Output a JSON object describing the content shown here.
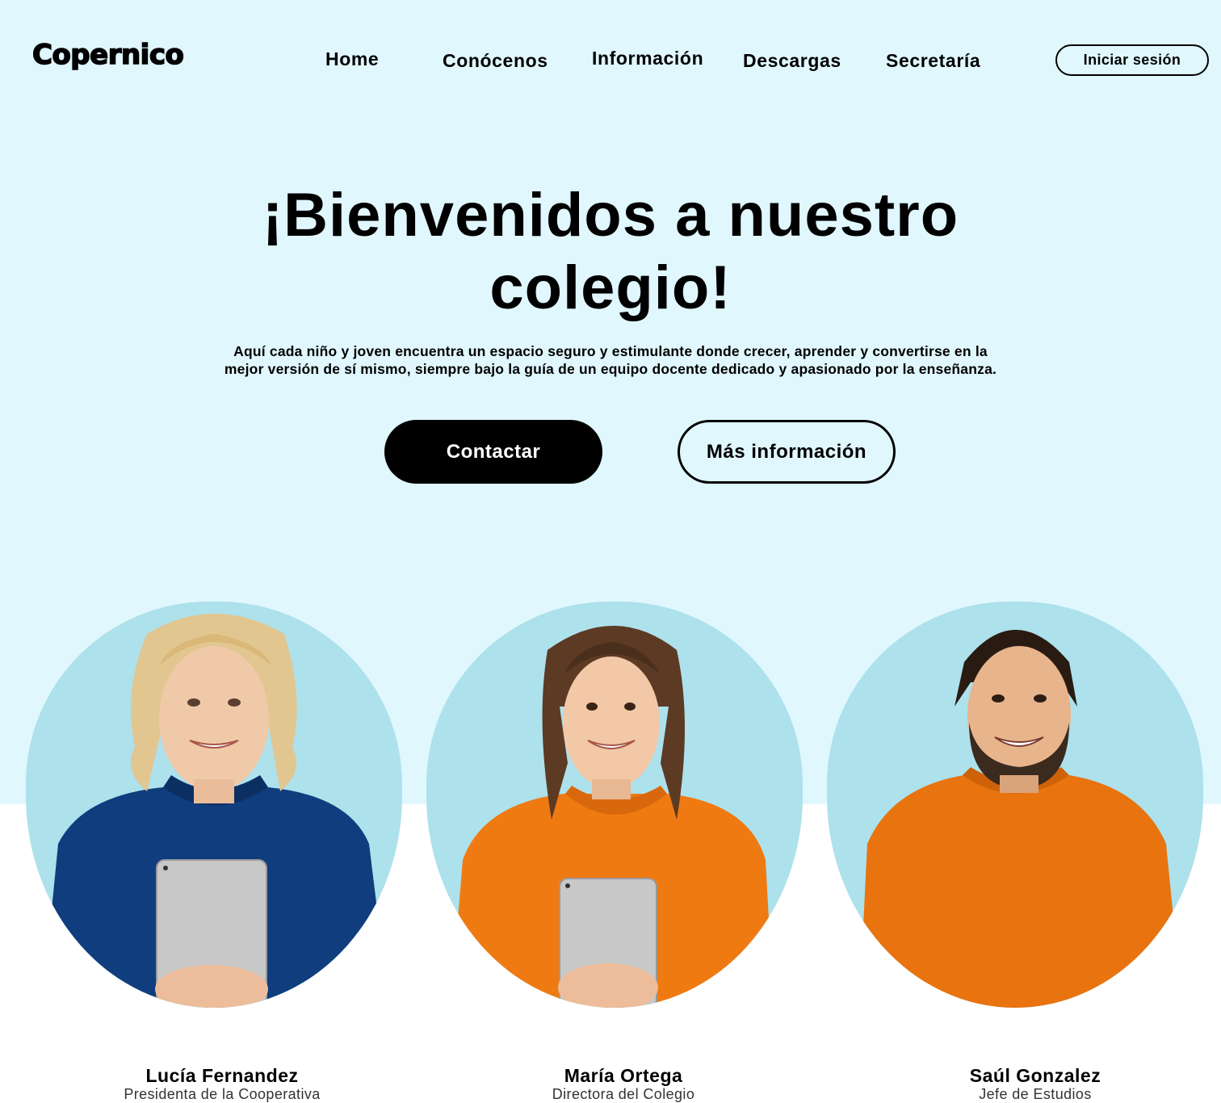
{
  "brand": {
    "logo_text": "Copernico"
  },
  "nav": {
    "items": [
      "Home",
      "Conócenos",
      "Información",
      "Descargas",
      "Secretaría"
    ],
    "login_label": "Iniciar sesión"
  },
  "hero": {
    "title_line1": "¡Bienvenidos a nuestro",
    "title_line2": "colegio!",
    "subtitle_line1": "Aquí cada niño y joven encuentra un espacio seguro y estimulante donde crecer, aprender y convertirse en la",
    "subtitle_line2": "mejor versión de sí mismo, siempre bajo la guía de un equipo docente dedicado y apasionado por la enseñanza.",
    "primary_button": "Contactar",
    "secondary_button": "Más información"
  },
  "team": [
    {
      "name": "Lucía Fernandez",
      "role": "Presidenta de la Cooperativa"
    },
    {
      "name": "María Ortega",
      "role": "Directora del Colegio"
    },
    {
      "name": "Saúl Gonzalez",
      "role": "Jefe de Estudios"
    }
  ],
  "colors": {
    "hero_background": "#e0f7fe",
    "portrait_background": "#ade1ec",
    "primary_button": "#000000",
    "blue_shirt": "#0f3d7e",
    "orange_sweater": "#f07a12"
  }
}
